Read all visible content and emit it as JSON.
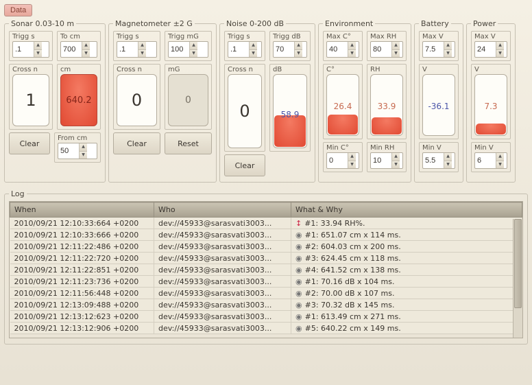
{
  "top_button": "Data",
  "sonar": {
    "legend": "Sonar 0.03-10 m",
    "trigg_s": {
      "label": "Trigg s",
      "value": ".1"
    },
    "to_cm": {
      "label": "To cm",
      "value": "700"
    },
    "cross_n": {
      "label": "Cross n",
      "value": "1"
    },
    "cm": {
      "label": "cm",
      "value": "640.2"
    },
    "clear": "Clear",
    "from_cm": {
      "label": "From cm",
      "value": "50"
    }
  },
  "magnetometer": {
    "legend": "Magnetometer ±2 G",
    "trigg_s": {
      "label": "Trigg s",
      "value": ".1"
    },
    "trigg_mg": {
      "label": "Trigg mG",
      "value": "100"
    },
    "cross_n": {
      "label": "Cross n",
      "value": "0"
    },
    "mg": {
      "label": "mG",
      "value": "0"
    },
    "clear": "Clear",
    "reset": "Reset"
  },
  "noise": {
    "legend": "Noise 0-200 dB",
    "trigg_s": {
      "label": "Trigg s",
      "value": ".1"
    },
    "trigg_db": {
      "label": "Trigg dB",
      "value": "70"
    },
    "cross_n": {
      "label": "Cross n",
      "value": "0"
    },
    "db": {
      "label": "dB",
      "value": "58.9",
      "fill_pct": 43
    },
    "clear": "Clear"
  },
  "environment": {
    "legend": "Environment",
    "max_c": {
      "label": "Max C°",
      "value": "40"
    },
    "max_rh": {
      "label": "Max RH",
      "value": "80"
    },
    "c": {
      "label": "C°",
      "value": "26.4",
      "fill_pct": 33
    },
    "rh": {
      "label": "RH",
      "value": "33.9",
      "fill_pct": 28
    },
    "min_c": {
      "label": "Min C°",
      "value": "0"
    },
    "min_rh": {
      "label": "Min RH",
      "value": "10"
    }
  },
  "battery": {
    "legend": "Battery",
    "max_v": {
      "label": "Max V",
      "value": "7.5"
    },
    "v": {
      "label": "V",
      "value": "-36.1",
      "fill_pct": 0
    },
    "min_v": {
      "label": "Min V",
      "value": "5.5"
    }
  },
  "power": {
    "legend": "Power",
    "max_v": {
      "label": "Max V",
      "value": "24"
    },
    "v": {
      "label": "V",
      "value": "7.3",
      "fill_pct": 18
    },
    "min_v": {
      "label": "Min V",
      "value": "6"
    }
  },
  "log": {
    "legend": "Log",
    "columns": [
      "When",
      "Who",
      "What & Why"
    ],
    "rows": [
      [
        "2010/09/21 12:10:33:664 +0200",
        "dev://45933@sarasvati3003...",
        "↕ #1: 33.94 RH%."
      ],
      [
        "2010/09/21 12:10:33:666 +0200",
        "dev://45933@sarasvati3003...",
        "⊕ #1: 651.07 cm x 114 ms."
      ],
      [
        "2010/09/21 12:11:22:486 +0200",
        "dev://45933@sarasvati3003...",
        "⊕ #2: 604.03 cm x 200 ms."
      ],
      [
        "2010/09/21 12:11:22:720 +0200",
        "dev://45933@sarasvati3003...",
        "⊕ #3: 624.45 cm x 118 ms."
      ],
      [
        "2010/09/21 12:11:22:851 +0200",
        "dev://45933@sarasvati3003...",
        "⊕ #4: 641.52 cm x 138 ms."
      ],
      [
        "2010/09/21 12:11:23:736 +0200",
        "dev://45933@sarasvati3003...",
        "⊕ #1: 70.16 dB x 104 ms."
      ],
      [
        "2010/09/21 12:11:56:448 +0200",
        "dev://45933@sarasvati3003...",
        "⊕ #2: 70.00 dB x 107 ms."
      ],
      [
        "2010/09/21 12:13:09:488 +0200",
        "dev://45933@sarasvati3003...",
        "⊕ #3: 70.32 dB x 145 ms."
      ],
      [
        "2010/09/21 12:13:12:623 +0200",
        "dev://45933@sarasvati3003...",
        "⊕ #1: 613.49 cm x 271 ms."
      ],
      [
        "2010/09/21 12:13:12:906 +0200",
        "dev://45933@sarasvati3003...",
        "⊕ #5: 640.22 cm x 149 ms."
      ]
    ]
  }
}
